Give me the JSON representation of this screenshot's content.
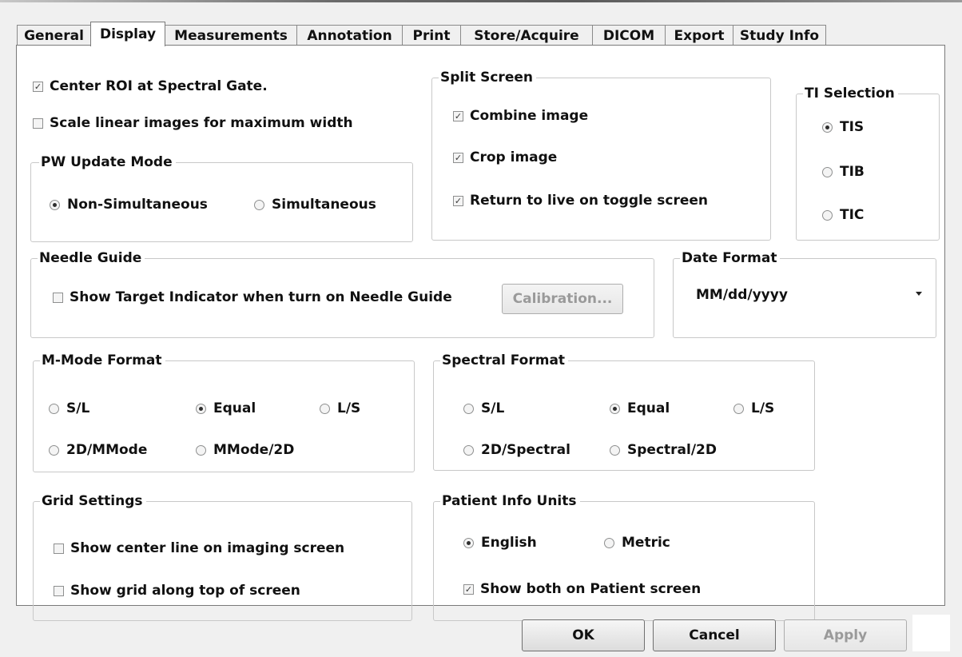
{
  "tabs": [
    {
      "label": "General",
      "active": false
    },
    {
      "label": "Display",
      "active": true
    },
    {
      "label": "Measurements",
      "active": false
    },
    {
      "label": "Annotation",
      "active": false
    },
    {
      "label": "Print",
      "active": false
    },
    {
      "label": "Store/Acquire",
      "active": false
    },
    {
      "label": "DICOM",
      "active": false
    },
    {
      "label": "Export",
      "active": false
    },
    {
      "label": "Study Info",
      "active": false
    }
  ],
  "general": {
    "center_roi": {
      "label": "Center ROI at Spectral Gate.",
      "checked": true
    },
    "scale_linear": {
      "label": "Scale linear images for maximum width",
      "checked": false
    }
  },
  "pw_update_mode": {
    "title": "PW Update Mode",
    "options": [
      {
        "label": "Non-Simultaneous",
        "selected": true
      },
      {
        "label": "Simultaneous",
        "selected": false
      }
    ]
  },
  "split_screen": {
    "title": "Split Screen",
    "combine_image": {
      "label": "Combine image",
      "checked": true
    },
    "crop_image": {
      "label": "Crop image",
      "checked": true
    },
    "return_live": {
      "label": "Return to live on toggle screen",
      "checked": true
    }
  },
  "ti_selection": {
    "title": "TI Selection",
    "options": [
      {
        "label": "TIS",
        "selected": true
      },
      {
        "label": "TIB",
        "selected": false
      },
      {
        "label": "TIC",
        "selected": false
      }
    ]
  },
  "needle_guide": {
    "title": "Needle Guide",
    "show_target": {
      "label": "Show Target Indicator when turn on Needle Guide",
      "checked": false
    },
    "calibration_label": "Calibration..."
  },
  "date_format": {
    "title": "Date Format",
    "value": "MM/dd/yyyy"
  },
  "mmode_format": {
    "title": "M-Mode Format",
    "options": [
      {
        "label": "S/L",
        "selected": false
      },
      {
        "label": "Equal",
        "selected": true
      },
      {
        "label": "L/S",
        "selected": false
      },
      {
        "label": "2D/MMode",
        "selected": false
      },
      {
        "label": "MMode/2D",
        "selected": false
      }
    ]
  },
  "spectral_format": {
    "title": "Spectral Format",
    "options": [
      {
        "label": "S/L",
        "selected": false
      },
      {
        "label": "Equal",
        "selected": true
      },
      {
        "label": "L/S",
        "selected": false
      },
      {
        "label": "2D/Spectral",
        "selected": false
      },
      {
        "label": "Spectral/2D",
        "selected": false
      }
    ]
  },
  "grid_settings": {
    "title": "Grid Settings",
    "center_line": {
      "label": "Show center line on imaging screen",
      "checked": false
    },
    "grid_top": {
      "label": "Show grid along top of screen",
      "checked": false
    }
  },
  "patient_info_units": {
    "title": "Patient Info Units",
    "options": [
      {
        "label": "English",
        "selected": true
      },
      {
        "label": "Metric",
        "selected": false
      }
    ],
    "show_both": {
      "label": "Show both on Patient screen",
      "checked": true
    }
  },
  "footer": {
    "ok_label": "OK",
    "cancel_label": "Cancel",
    "apply_label": "Apply"
  }
}
